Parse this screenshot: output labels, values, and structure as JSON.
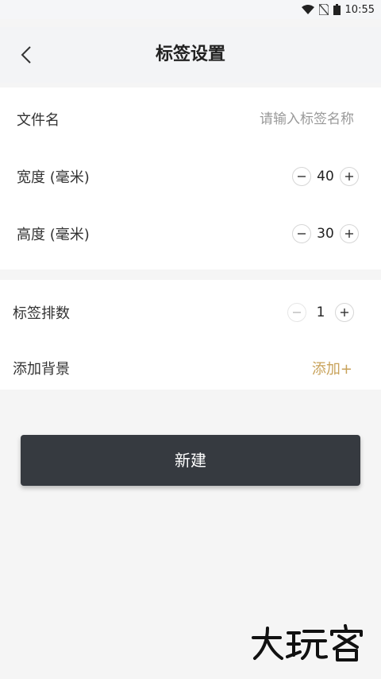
{
  "status_bar": {
    "time": "10:55"
  },
  "header": {
    "title": "标签设置"
  },
  "form": {
    "file_name": {
      "label": "文件名",
      "placeholder": "请输入标签名称",
      "value": ""
    },
    "width": {
      "label": "宽度 (毫米)",
      "value": "40"
    },
    "height": {
      "label": "高度 (毫米)",
      "value": "30"
    },
    "rows": {
      "label": "标签排数",
      "value": "1"
    },
    "background": {
      "label": "添加背景",
      "action": "添加+"
    }
  },
  "primary_button": {
    "label": "新建"
  },
  "watermark": {
    "text": "大玩客"
  },
  "colors": {
    "accent": "#c8a25a",
    "button_bg": "#363a40",
    "page_bg": "#f5f5f5"
  }
}
